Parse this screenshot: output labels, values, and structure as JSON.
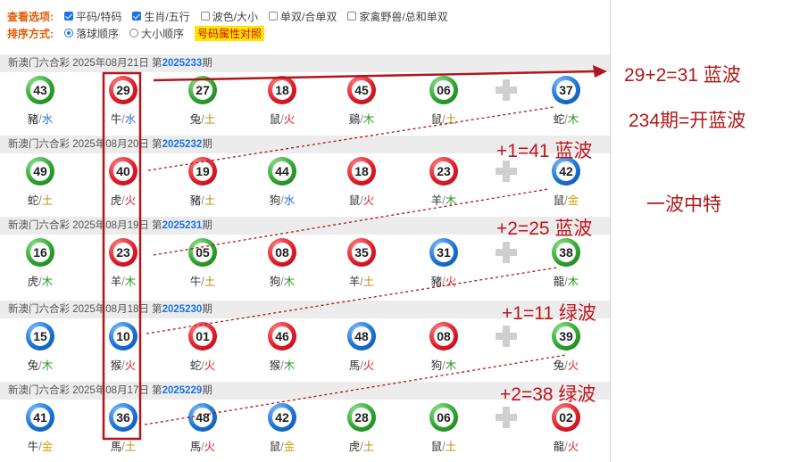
{
  "options": {
    "view_title": "查看选项:",
    "view_items": [
      {
        "label": "平码/特码",
        "checked": true
      },
      {
        "label": "生肖/五行",
        "checked": true
      },
      {
        "label": "波色/大小",
        "checked": false
      },
      {
        "label": "单双/合单双",
        "checked": false
      },
      {
        "label": "家禽野兽/总和单双",
        "checked": false
      }
    ],
    "sort_title": "排序方式:",
    "sort_items": [
      {
        "label": "落球顺序",
        "selected": true
      },
      {
        "label": "大小顺序",
        "selected": false
      }
    ],
    "attr_button": "号码属性对照"
  },
  "draws": [
    {
      "prefix": "新澳门六合彩 2025年08月21日 第",
      "period": "2025233",
      "suffix": "期",
      "balls": [
        {
          "n": "43",
          "c": "green",
          "z": "豬",
          "e": "水"
        },
        {
          "n": "29",
          "c": "red",
          "z": "牛",
          "e": "水"
        },
        {
          "n": "27",
          "c": "green",
          "z": "兔",
          "e": "土"
        },
        {
          "n": "18",
          "c": "red",
          "z": "鼠",
          "e": "火"
        },
        {
          "n": "45",
          "c": "red",
          "z": "鷄",
          "e": "木"
        },
        {
          "n": "06",
          "c": "green",
          "z": "鼠",
          "e": "土"
        },
        {
          "n": "37",
          "c": "blue",
          "z": "蛇",
          "e": "木"
        }
      ]
    },
    {
      "prefix": "新澳门六合彩 2025年08月20日 第",
      "period": "2025232",
      "suffix": "期",
      "balls": [
        {
          "n": "49",
          "c": "green",
          "z": "蛇",
          "e": "土"
        },
        {
          "n": "40",
          "c": "red",
          "z": "虎",
          "e": "火"
        },
        {
          "n": "19",
          "c": "red",
          "z": "豬",
          "e": "土"
        },
        {
          "n": "44",
          "c": "green",
          "z": "狗",
          "e": "水"
        },
        {
          "n": "18",
          "c": "red",
          "z": "鼠",
          "e": "火"
        },
        {
          "n": "23",
          "c": "red",
          "z": "羊",
          "e": "木"
        },
        {
          "n": "42",
          "c": "blue",
          "z": "鼠",
          "e": "金"
        }
      ]
    },
    {
      "prefix": "新澳门六合彩 2025年08月19日 第",
      "period": "2025231",
      "suffix": "期",
      "balls": [
        {
          "n": "16",
          "c": "green",
          "z": "虎",
          "e": "木"
        },
        {
          "n": "23",
          "c": "red",
          "z": "羊",
          "e": "木"
        },
        {
          "n": "05",
          "c": "green",
          "z": "牛",
          "e": "土"
        },
        {
          "n": "08",
          "c": "red",
          "z": "狗",
          "e": "木"
        },
        {
          "n": "35",
          "c": "red",
          "z": "羊",
          "e": "土"
        },
        {
          "n": "31",
          "c": "blue",
          "z": "豬",
          "e": "火"
        },
        {
          "n": "38",
          "c": "green",
          "z": "龍",
          "e": "木"
        }
      ]
    },
    {
      "prefix": "新澳门六合彩 2025年08月18日 第",
      "period": "2025230",
      "suffix": "期",
      "balls": [
        {
          "n": "15",
          "c": "blue",
          "z": "兔",
          "e": "木"
        },
        {
          "n": "10",
          "c": "blue",
          "z": "猴",
          "e": "火"
        },
        {
          "n": "01",
          "c": "red",
          "z": "蛇",
          "e": "火"
        },
        {
          "n": "46",
          "c": "red",
          "z": "猴",
          "e": "木"
        },
        {
          "n": "48",
          "c": "blue",
          "z": "馬",
          "e": "火"
        },
        {
          "n": "08",
          "c": "red",
          "z": "狗",
          "e": "木"
        },
        {
          "n": "39",
          "c": "green",
          "z": "兔",
          "e": "火"
        }
      ]
    },
    {
      "prefix": "新澳门六合彩 2025年08月17日 第",
      "period": "2025229",
      "suffix": "期",
      "balls": [
        {
          "n": "41",
          "c": "blue",
          "z": "牛",
          "e": "金"
        },
        {
          "n": "36",
          "c": "blue",
          "z": "馬",
          "e": "土"
        },
        {
          "n": "48",
          "c": "blue",
          "z": "馬",
          "e": "火"
        },
        {
          "n": "42",
          "c": "blue",
          "z": "鼠",
          "e": "金"
        },
        {
          "n": "28",
          "c": "green",
          "z": "虎",
          "e": "土"
        },
        {
          "n": "06",
          "c": "green",
          "z": "鼠",
          "e": "土"
        },
        {
          "n": "02",
          "c": "red",
          "z": "龍",
          "e": "火"
        }
      ]
    }
  ],
  "annotations": {
    "a1": "29+2=31 蓝波",
    "a2": "234期=开蓝波",
    "a3": "+1=41 蓝波",
    "a4": "一波中特",
    "a5": "+2=25 蓝波",
    "a6": "+1=11 绿波",
    "a7": "+2=38 绿波"
  },
  "colors": {
    "red": "#e0202a",
    "blue": "#1a73d6",
    "green": "#2fa52f",
    "annotation": "#c0141c"
  },
  "icons": [
    "checkbox-icon",
    "radio-icon",
    "plus-icon"
  ]
}
